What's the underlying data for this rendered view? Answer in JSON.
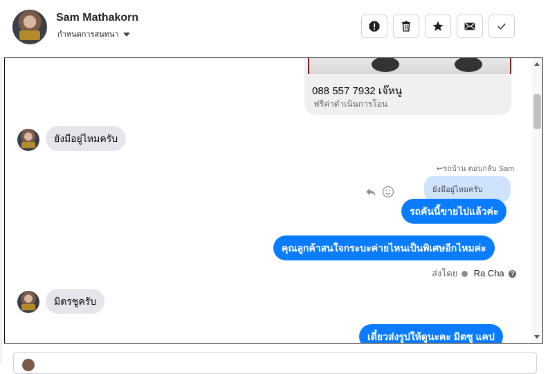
{
  "contact": {
    "name": "Sam Mathakorn",
    "status_label": "กำหนดการสนทนา"
  },
  "toolbar": {
    "buttons": [
      {
        "name": "spam-button",
        "icon": "alert-octagon-icon"
      },
      {
        "name": "delete-button",
        "icon": "trash-icon"
      },
      {
        "name": "star-button",
        "icon": "star-icon"
      },
      {
        "name": "mark-unread-button",
        "icon": "envelope-icon"
      },
      {
        "name": "done-button",
        "icon": "check-icon"
      }
    ]
  },
  "messages": {
    "card_phone": "088 557 7932 เจ๊หนู",
    "card_note": "ฟรีค่าดำเนินการโอน",
    "incoming_1": "ยังมีอยู่ไหมครับ",
    "reply_meta": "รถบ้าน ตอบกลับ Sam",
    "quoted_text": "ยังมีอยู่ไหมครับ",
    "outgoing_1": "รถคันนี้ขายไปแล้วค่ะ",
    "outgoing_2": "คุณลูกค้าสนใจกระบะค่ายไหนเป็นพิเศษอีกไหมค่ะ",
    "sent_by_label": "ส่งโดย",
    "sent_by_agent": "Ra Cha",
    "incoming_2": "มิตรชูครับ",
    "outgoing_3": "เดี๋ยวส่งรูปให้ดูนะคะ มิตซู แคป"
  },
  "colors": {
    "outgoing_bubble": "#0a7cff",
    "incoming_bubble": "#e4e6eb",
    "quoted_bubble": "#cfe3fd"
  }
}
